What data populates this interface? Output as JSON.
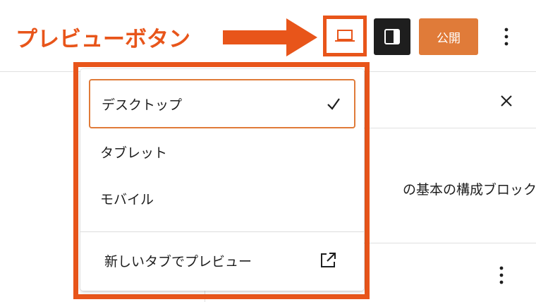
{
  "annotation": {
    "label": "プレビューボタン",
    "color": "#e8551a"
  },
  "toolbar": {
    "preview_icon": "laptop-icon",
    "settings_icon": "sidebar-toggle-icon",
    "publish_label": "公開",
    "more_icon": "kebab-menu-icon",
    "publish_color": "#e07b39"
  },
  "background": {
    "close_icon": "close-icon",
    "body_text": "の基本の構成ブロック",
    "more_icon": "kebab-menu-icon"
  },
  "preview_menu": {
    "items": [
      {
        "label": "デスクトップ",
        "selected": true
      },
      {
        "label": "タブレット",
        "selected": false
      },
      {
        "label": "モバイル",
        "selected": false
      }
    ],
    "check_icon": "check-icon",
    "external": {
      "label": "新しいタブでプレビュー",
      "icon": "external-link-icon"
    }
  }
}
